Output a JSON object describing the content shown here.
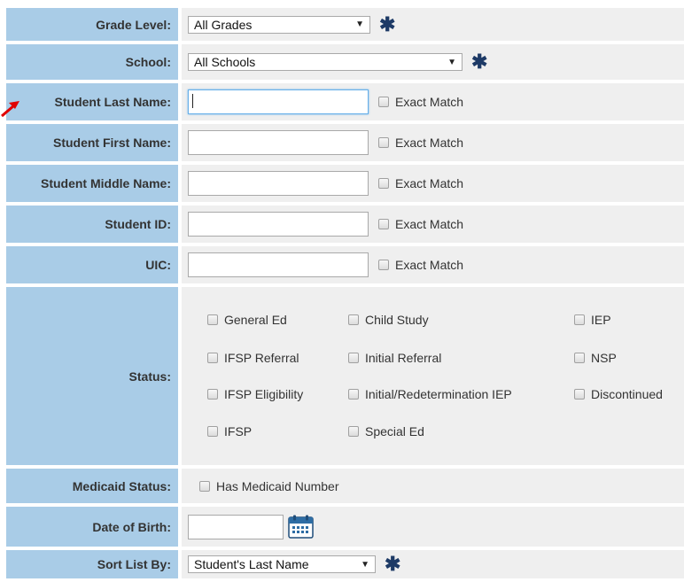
{
  "grade_level": {
    "label": "Grade Level:",
    "value": "All Grades"
  },
  "school": {
    "label": "School:",
    "value": "All Schools"
  },
  "exact_match_label": "Exact Match",
  "text_fields": [
    {
      "label": "Student Last Name:",
      "value": ""
    },
    {
      "label": "Student First Name:",
      "value": ""
    },
    {
      "label": "Student Middle Name:",
      "value": ""
    },
    {
      "label": "Student ID:",
      "value": ""
    },
    {
      "label": "UIC:",
      "value": ""
    }
  ],
  "status": {
    "label": "Status:",
    "options": [
      "General Ed",
      "Child Study",
      "IEP",
      "IFSP Referral",
      "Initial Referral",
      "NSP",
      "IFSP Eligibility",
      "Initial/Redetermination IEP",
      "Discontinued",
      "IFSP",
      "Special Ed"
    ]
  },
  "medicaid": {
    "label": "Medicaid Status:",
    "option": "Has Medicaid Number"
  },
  "dob": {
    "label": "Date of Birth:",
    "value": ""
  },
  "sort": {
    "label": "Sort List By:",
    "value": "Student's Last Name"
  },
  "required_marker": "✱",
  "colors": {
    "label_bg": "#a9cce7",
    "value_bg": "#efefef",
    "marker": "#1d3a66",
    "arrow": "#e00000"
  }
}
